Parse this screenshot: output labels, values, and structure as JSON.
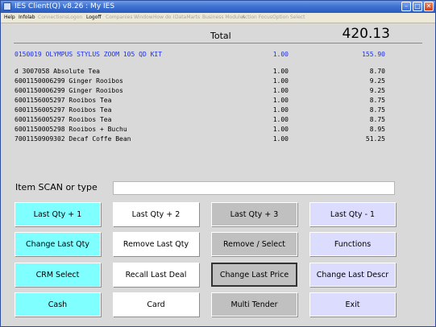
{
  "window": {
    "title": "IES Client(Q) v8.26 : My IES"
  },
  "menu": [
    {
      "label": "Help",
      "enabled": true
    },
    {
      "label": "Infolab",
      "enabled": true
    },
    {
      "label": "Connections",
      "enabled": false
    },
    {
      "label": "Logon",
      "enabled": false
    },
    {
      "label": "Logoff",
      "enabled": true
    },
    {
      "label": "Companies",
      "enabled": false
    },
    {
      "label": "Window",
      "enabled": false
    },
    {
      "label": "How do I",
      "enabled": false
    },
    {
      "label": "DataMarts",
      "enabled": false
    },
    {
      "label": "Business Modules",
      "enabled": false
    },
    {
      "label": "Action Focus",
      "enabled": false
    },
    {
      "label": "Option Select",
      "enabled": false
    }
  ],
  "totals": {
    "label": "Total",
    "value": "420.13"
  },
  "items": [
    {
      "desc": "0150019 OLYMPUS STYLUS ZOOM 105 QD KIT",
      "qty": "1.00",
      "price": "155.90",
      "highlight": true
    },
    {
      "desc": "d 3007058 Absolute Tea",
      "qty": "1.00",
      "price": "8.70",
      "highlight": false
    },
    {
      "desc": "6001150006299 Ginger Rooibos",
      "qty": "1.00",
      "price": "9.25",
      "highlight": false
    },
    {
      "desc": "6001150006299 Ginger Rooibos",
      "qty": "1.00",
      "price": "9.25",
      "highlight": false
    },
    {
      "desc": "6001156005297 Rooibos Tea",
      "qty": "1.00",
      "price": "8.75",
      "highlight": false
    },
    {
      "desc": "6001156005297 Rooibos Tea",
      "qty": "1.00",
      "price": "8.75",
      "highlight": false
    },
    {
      "desc": "6001156005297 Rooibos Tea",
      "qty": "1.00",
      "price": "8.75",
      "highlight": false
    },
    {
      "desc": "6001150005298 Rooibos + Buchu",
      "qty": "1.00",
      "price": "8.95",
      "highlight": false
    },
    {
      "desc": "7001150909302 Decaf Coffe Bean",
      "qty": "1.00",
      "price": "51.25",
      "highlight": false
    }
  ],
  "scan": {
    "label": "Item SCAN or type",
    "value": ""
  },
  "buttons": [
    [
      "Last Qty + 1",
      "Last Qty + 2",
      "Last Qty + 3",
      "Last Qty - 1"
    ],
    [
      "Change Last Qty",
      "Remove Last Qty",
      "Remove / Select",
      "Functions"
    ],
    [
      "CRM Select",
      "Recall Last Deal",
      "Change Last Price",
      "Change Last Descr"
    ],
    [
      "Cash",
      "Card",
      "Multi Tender",
      "Exit"
    ]
  ],
  "colors": {
    "col1": "#7fffff",
    "col2": "#ffffff",
    "col3": "#c0c0c0",
    "col4": "#dcdcff",
    "highlight_text": "#1c2ff0"
  }
}
